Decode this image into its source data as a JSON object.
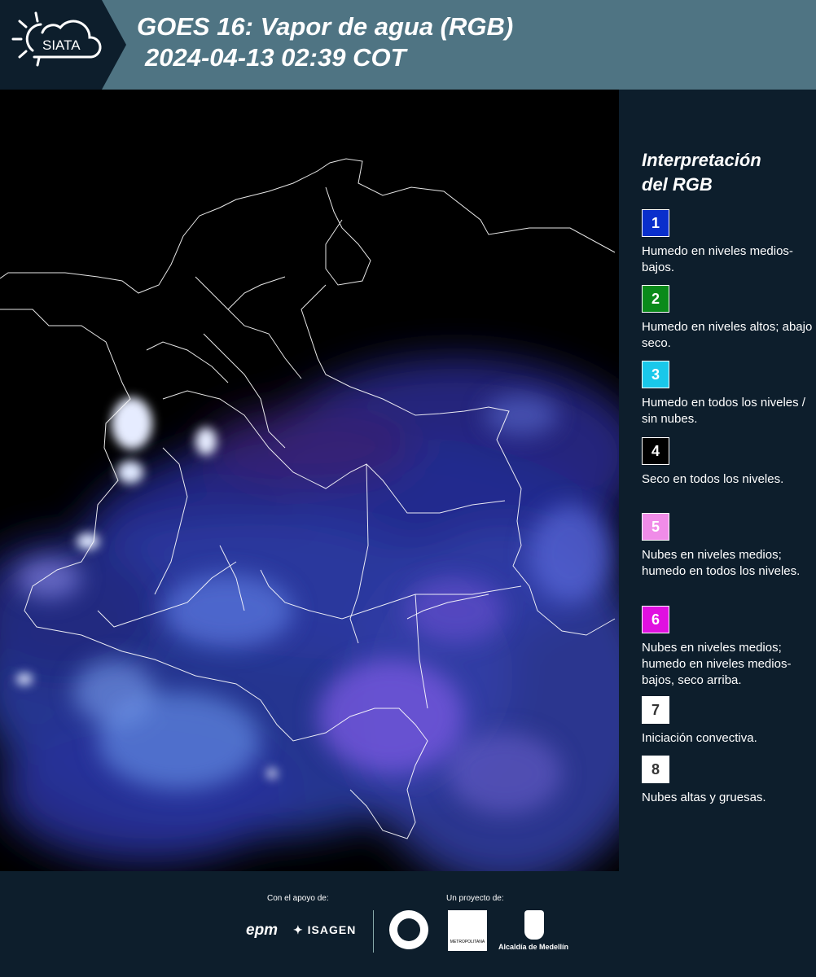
{
  "header": {
    "logo_text": "SIATA",
    "title_line1": "GOES 16: Vapor de agua (RGB)",
    "title_line2": "2024-04-13 02:39 COT"
  },
  "legend": {
    "title_line1": "Interpretación",
    "title_line2": "del RGB",
    "items": [
      {
        "num": "1",
        "color": "#0a2fcc",
        "text_color": "#ffffff",
        "label": "Humedo en niveles medios-bajos."
      },
      {
        "num": "2",
        "color": "#0a8a1a",
        "text_color": "#ffffff",
        "label": "Humedo en niveles altos; abajo seco."
      },
      {
        "num": "3",
        "color": "#19c8ea",
        "text_color": "#ffffff",
        "label": "Humedo en todos los niveles / sin nubes."
      },
      {
        "num": "4",
        "color": "#000000",
        "text_color": "#ffffff",
        "label": "Seco en todos los niveles."
      },
      {
        "num": "5",
        "color": "#f08ce8",
        "text_color": "#ffffff",
        "label": "Nubes en niveles medios; humedo en todos los niveles."
      },
      {
        "num": "6",
        "color": "#e010e0",
        "text_color": "#ffffff",
        "label": "Nubes en niveles medios; humedo en niveles medios-bajos, seco arriba."
      },
      {
        "num": "7",
        "color": "#ffffff",
        "text_color": "#333333",
        "label": "Iniciación convectiva."
      },
      {
        "num": "8",
        "color": "#ffffff",
        "text_color": "#333333",
        "label": "Nubes altas y gruesas."
      }
    ]
  },
  "footer": {
    "support_label": "Con el apoyo de:",
    "project_label": "Un proyecto de:",
    "sponsor_epm": "epm",
    "sponsor_isagen": "ISAGEN",
    "metro_text": "METROPOLITANA",
    "alcaldia": "Alcaldía de Medellín"
  },
  "colors": {
    "header_bg": "#4f7483",
    "logo_bg": "#0d1e2c",
    "panel_bg": "#0d1e2c"
  }
}
